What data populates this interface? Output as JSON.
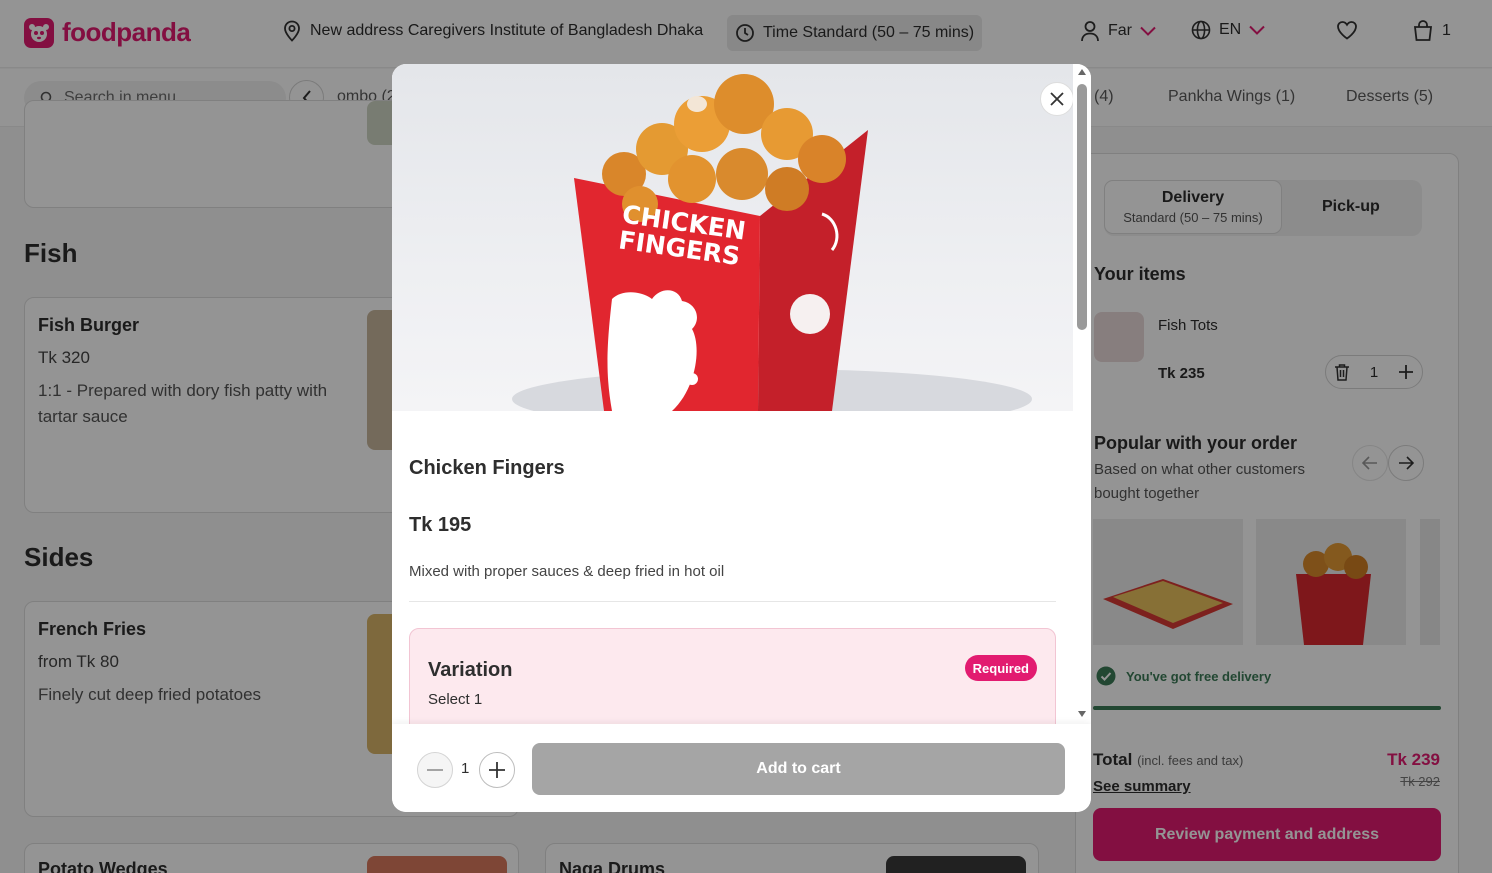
{
  "header": {
    "logo_text": "foodpanda",
    "address": "New address Caregivers Institute of Bangladesh Dhaka",
    "time": "Time Standard (50 – 75 mins)",
    "user": "Far",
    "language": "EN",
    "cart_count": "1"
  },
  "subnav": {
    "search_placeholder": "Search in menu",
    "tabs": [
      "ombo (2",
      "(4)",
      "Pankha Wings (1)",
      "Desserts (5)"
    ]
  },
  "menu": {
    "fish_title": "Fish",
    "fish_burger": {
      "name": "Fish Burger",
      "price": "Tk 320",
      "desc": "1:1 - Prepared with dory fish patty with tartar sauce"
    },
    "sides_title": "Sides",
    "french_fries": {
      "name": "French Fries",
      "price": "from Tk 80",
      "desc": "Finely cut deep fried potatoes"
    },
    "potato_wedges": "Potato Wedges",
    "naga_drums": "Naga Drums"
  },
  "cart": {
    "delivery_label": "Delivery",
    "delivery_sub": "Standard (50 – 75 mins)",
    "pickup_label": "Pick-up",
    "your_items": "Your items",
    "item_name": "Fish Tots",
    "item_price": "Tk 235",
    "item_qty": "1",
    "popular_title": "Popular with your order",
    "popular_sub": "Based on what other customers bought together",
    "free_delivery": "You've got free delivery",
    "total_label": "Total",
    "total_note": "(incl. fees and tax)",
    "see_summary": "See summary",
    "total_price": "Tk 239",
    "total_old": "Tk 292",
    "review_button": "Review payment and address"
  },
  "modal": {
    "box_text_1": "CHICKEN",
    "box_text_2": "FINGERS",
    "title": "Chicken Fingers",
    "price": "Tk 195",
    "desc": "Mixed with proper sauces & deep fried in hot oil",
    "variation_title": "Variation",
    "variation_sub": "Select 1",
    "required": "Required",
    "qty": "1",
    "add_button": "Add to cart"
  },
  "colors": {
    "brand": "#e21b70",
    "free_delivery": "#3b7a57",
    "add_disabled": "#a5a5a5"
  }
}
